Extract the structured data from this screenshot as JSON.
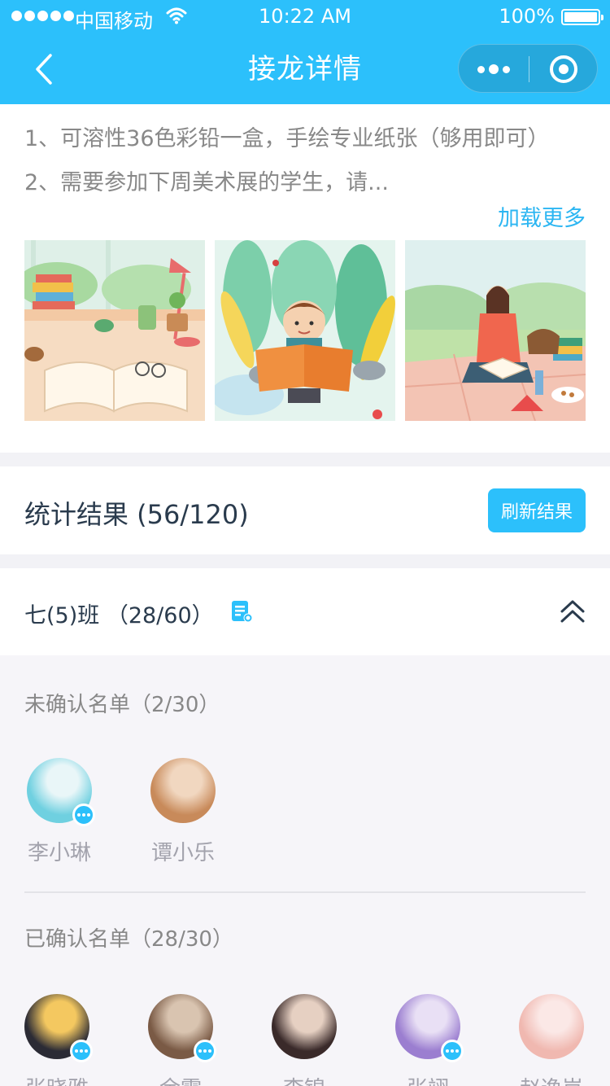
{
  "status_bar": {
    "carrier": "中国移动",
    "time": "10:22 AM",
    "battery": "100%"
  },
  "nav": {
    "title": "接龙详情"
  },
  "description": {
    "line1": "1、可溶性36色彩铅一盒，手绘专业纸张（够用即可）",
    "line2": "2、需要参加下周美术展的学生，请...",
    "load_more": "加载更多"
  },
  "images": [
    {
      "name": "desk-books-illustration"
    },
    {
      "name": "boy-reading-illustration"
    },
    {
      "name": "girl-picnic-illustration"
    }
  ],
  "stats": {
    "title": "统计结果 (56/120)",
    "refresh_label": "刷新结果"
  },
  "class_group": {
    "title": "七(5)班 （28/60）"
  },
  "unconfirmed": {
    "label": "未确认名单（2/30）",
    "members": [
      {
        "name": "李小琳",
        "has_chat": true,
        "color1": "#6fd0e0",
        "color2": "#e9f6f8"
      },
      {
        "name": "谭小乐",
        "has_chat": false,
        "color1": "#c88a5a",
        "color2": "#f1d7c0"
      }
    ]
  },
  "confirmed": {
    "label": "已确认名单（28/30）",
    "members": [
      {
        "name": "张晓雅",
        "has_chat": true,
        "color1": "#2b2b35",
        "color2": "#f4c860"
      },
      {
        "name": "余霏",
        "has_chat": true,
        "color1": "#7a5a45",
        "color2": "#d9c4b0"
      },
      {
        "name": "李锦",
        "has_chat": false,
        "color1": "#3a2a2a",
        "color2": "#e6d0c2"
      },
      {
        "name": "张翊",
        "has_chat": true,
        "color1": "#9b7ed0",
        "color2": "#e9e0f5"
      },
      {
        "name": "赵逸岚",
        "has_chat": false,
        "color1": "#f0b8b0",
        "color2": "#fbe8e6"
      }
    ]
  },
  "colors": {
    "primary": "#2cc0fb",
    "link": "#2cb6f2"
  }
}
